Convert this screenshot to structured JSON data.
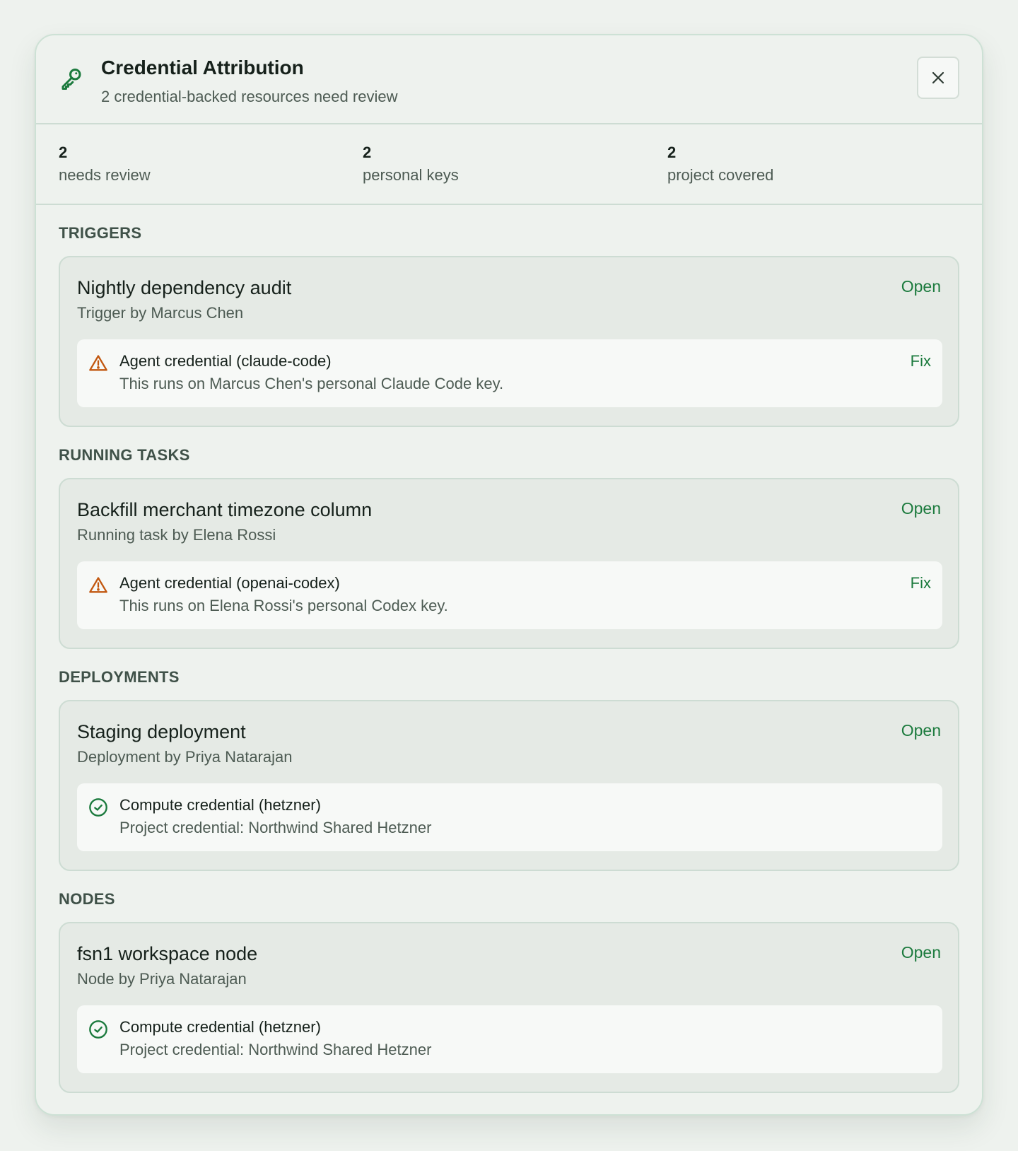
{
  "header": {
    "title": "Credential Attribution",
    "subtitle": "2 credential-backed resources need review",
    "close_icon": "close-icon",
    "key_icon": "key-icon"
  },
  "stats": [
    {
      "value": "2",
      "label": "needs review"
    },
    {
      "value": "2",
      "label": "personal keys"
    },
    {
      "value": "2",
      "label": "project covered"
    }
  ],
  "sections": [
    {
      "title": "TRIGGERS",
      "item": {
        "name": "Nightly dependency audit",
        "by": "Trigger by Marcus Chen",
        "open_label": "Open",
        "credential": {
          "status": "warning",
          "icon": "warning-icon",
          "title": "Agent credential (claude-code)",
          "desc": "This runs on Marcus Chen's personal Claude Code key.",
          "fix_label": "Fix"
        }
      }
    },
    {
      "title": "RUNNING TASKS",
      "item": {
        "name": "Backfill merchant timezone column",
        "by": "Running task by Elena Rossi",
        "open_label": "Open",
        "credential": {
          "status": "warning",
          "icon": "warning-icon",
          "title": "Agent credential (openai-codex)",
          "desc": "This runs on Elena Rossi's personal Codex key.",
          "fix_label": "Fix"
        }
      }
    },
    {
      "title": "DEPLOYMENTS",
      "item": {
        "name": "Staging deployment",
        "by": "Deployment by Priya Natarajan",
        "open_label": "Open",
        "credential": {
          "status": "ok",
          "icon": "check-circle-icon",
          "title": "Compute credential (hetzner)",
          "desc": "Project credential: Northwind Shared Hetzner"
        }
      }
    },
    {
      "title": "NODES",
      "item": {
        "name": "fsn1 workspace node",
        "by": "Node by Priya Natarajan",
        "open_label": "Open",
        "credential": {
          "status": "ok",
          "icon": "check-circle-icon",
          "title": "Compute credential (hetzner)",
          "desc": "Project credential: Northwind Shared Hetzner"
        }
      }
    }
  ],
  "colors": {
    "accent": "#1b7a3d",
    "warning": "#c2570f",
    "panel_bg": "#eef2ee",
    "card_bg": "#e5eae5"
  }
}
